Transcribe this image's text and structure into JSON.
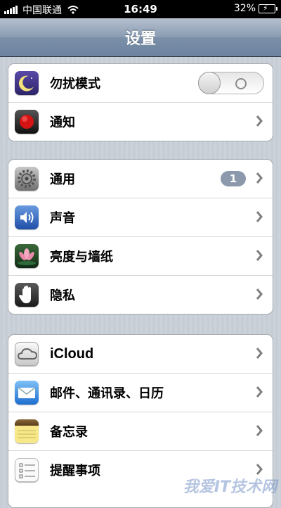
{
  "status": {
    "carrier": "中国联通",
    "time": "16:49",
    "battery": "32%"
  },
  "nav": {
    "title": "设置"
  },
  "groups": [
    {
      "items": [
        {
          "label": "勿扰模式",
          "icon": "moon-icon"
        },
        {
          "label": "通知",
          "icon": "notification-icon"
        }
      ]
    },
    {
      "items": [
        {
          "label": "通用",
          "icon": "gear-icon",
          "badge": "1"
        },
        {
          "label": "声音",
          "icon": "speaker-icon"
        },
        {
          "label": "亮度与墙纸",
          "icon": "flower-icon"
        },
        {
          "label": "隐私",
          "icon": "hand-icon"
        }
      ]
    },
    {
      "items": [
        {
          "label": "iCloud",
          "icon": "cloud-icon"
        },
        {
          "label": "邮件、通讯录、日历",
          "icon": "mail-icon"
        },
        {
          "label": "备忘录",
          "icon": "notes-icon"
        },
        {
          "label": "提醒事项",
          "icon": "reminders-icon"
        }
      ]
    }
  ],
  "watermark": "我爱IT技术网"
}
